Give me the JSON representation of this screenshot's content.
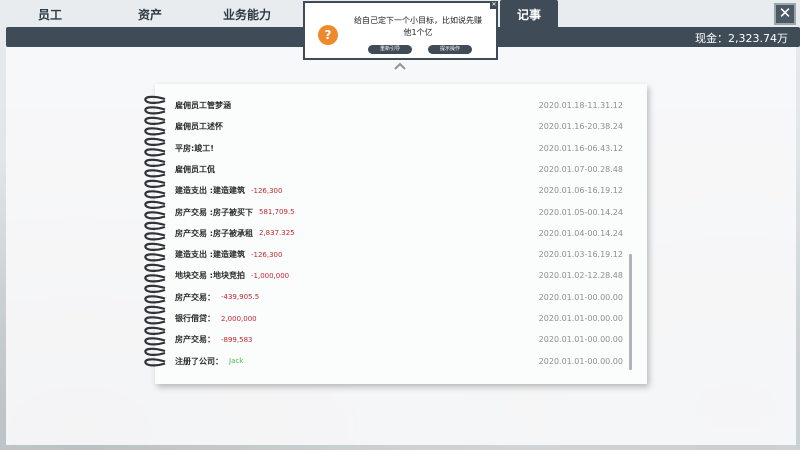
{
  "tabs": [
    {
      "label": "员工",
      "active": false
    },
    {
      "label": "资产",
      "active": false
    },
    {
      "label": "业务能力",
      "active": false
    },
    {
      "label": "记事",
      "active": true
    }
  ],
  "header": {
    "cash": "现金：2,323.74万",
    "close_glyph": "✕"
  },
  "popup": {
    "icon_glyph": "?",
    "message": "给自己定下一个小目标，比如说先赚他1个亿",
    "button_left": "重新引导",
    "button_right": "提示操作",
    "close_glyph": "✕"
  },
  "log": [
    {
      "text": "雇佣员工管梦涵",
      "amount": "",
      "amount_color": "",
      "date": "2020.01.18-11.31.12"
    },
    {
      "text": "雇佣员工述怀",
      "amount": "",
      "amount_color": "",
      "date": "2020.01.16-20.38.24"
    },
    {
      "text": "平房:竣工!",
      "amount": "",
      "amount_color": "",
      "date": "2020.01.16-06.43.12"
    },
    {
      "text": "雇佣员工侃",
      "amount": "",
      "amount_color": "",
      "date": "2020.01.07-00.28.48"
    },
    {
      "text": "建造支出 :建造建筑",
      "amount": "-126,300",
      "amount_color": "red",
      "date": "2020.01.06-16.19.12"
    },
    {
      "text": "房产交易 :房子被买下",
      "amount": "581,709.5",
      "amount_color": "red",
      "date": "2020.01.05-00.14.24"
    },
    {
      "text": "房产交易 :房子被承租",
      "amount": "2,837.325",
      "amount_color": "red",
      "date": "2020.01.04-00.14.24"
    },
    {
      "text": "建造支出 :建造建筑",
      "amount": "-126,300",
      "amount_color": "red",
      "date": "2020.01.03-16.19.12"
    },
    {
      "text": "地块交易 :地块竞拍",
      "amount": "-1,000,000",
      "amount_color": "red",
      "date": "2020.01.02-12.28.48"
    },
    {
      "text": "房产交易：",
      "amount": "-439,905.5",
      "amount_color": "red",
      "date": "2020.01.01-00.00.00"
    },
    {
      "text": "银行借贷：",
      "amount": "2,000,000",
      "amount_color": "red",
      "date": "2020.01.01-00.00.00"
    },
    {
      "text": "房产交易：",
      "amount": "-899,583",
      "amount_color": "red",
      "date": "2020.01.01-00.00.00"
    },
    {
      "text": "注册了公司：",
      "amount": "Jack",
      "amount_color": "green",
      "date": "2020.01.01-00.00.00"
    }
  ],
  "colors": {
    "accent_dark": "#3f4c57",
    "negative": "#c0282e",
    "positive": "#46b94a",
    "question_icon": "#ef8a2c"
  }
}
